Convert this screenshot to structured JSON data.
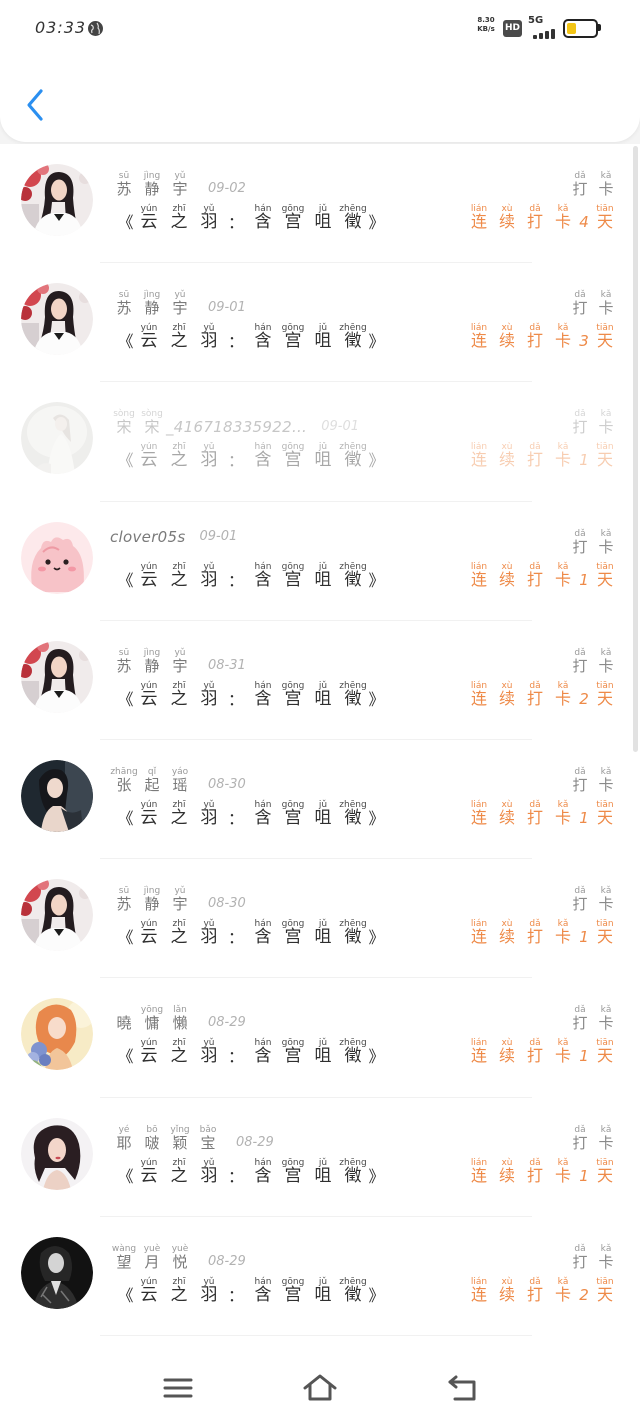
{
  "status_bar": {
    "time": "03:33",
    "net_speed": "8.30",
    "net_speed_unit": "KB/s",
    "hd_badge": "HD",
    "network_type": "5G",
    "signal_bars": 4,
    "battery_level": 0.35,
    "icons": {
      "globe": "globe-icon",
      "signal": "signal-icon",
      "battery": "battery-icon"
    }
  },
  "header": {
    "back_icon": "chevron-left-icon"
  },
  "colors": {
    "accent": "#2b8ff0",
    "streak": "#ee8a48",
    "name": "#7a7a7a",
    "date": "#b2b2b2",
    "title": "#2f2f2f",
    "label": "#8a8a8a",
    "nav": "#555555"
  },
  "checkin_label": [
    {
      "c": "打",
      "p": "dǎ"
    },
    {
      "c": "卡",
      "p": "kǎ"
    }
  ],
  "book_title": {
    "open": "《",
    "part1": [
      {
        "c": "云",
        "p": "yún"
      },
      {
        "c": "之",
        "p": "zhī"
      },
      {
        "c": "羽",
        "p": "yǔ"
      }
    ],
    "sep": "：",
    "part2": [
      {
        "c": "含",
        "p": "hán"
      },
      {
        "c": "宫",
        "p": "gōng"
      },
      {
        "c": "咀",
        "p": "jǔ"
      },
      {
        "c": "徵",
        "p": "zhēng"
      }
    ],
    "close": "》"
  },
  "streak": {
    "prefix": [
      {
        "c": "连",
        "p": "lián"
      },
      {
        "c": "续",
        "p": "xù"
      },
      {
        "c": "打",
        "p": "dǎ"
      },
      {
        "c": "卡",
        "p": "kǎ"
      }
    ],
    "suffix": {
      "c": "天",
      "p": "tiān"
    }
  },
  "records": [
    {
      "avatar": "girl-portrait",
      "name": [
        {
          "c": "苏",
          "p": "sū"
        },
        {
          "c": "静",
          "p": "jìng"
        },
        {
          "c": "宇",
          "p": "yǔ"
        }
      ],
      "date": "09-02",
      "days": "4"
    },
    {
      "avatar": "girl-portrait",
      "name": [
        {
          "c": "苏",
          "p": "sū"
        },
        {
          "c": "静",
          "p": "jìng"
        },
        {
          "c": "宇",
          "p": "yǔ"
        }
      ],
      "date": "09-01",
      "days": "3"
    },
    {
      "avatar": "pale-figure",
      "name": [
        {
          "c": "宋",
          "p": "sòng"
        },
        {
          "c": "宋",
          "p": "sòng"
        }
      ],
      "name_tail": "_416718335922…",
      "date": "09-01",
      "days": "1",
      "dimmed": true
    },
    {
      "avatar": "pink-cartoon",
      "name": [],
      "name_tail": "clover05s",
      "date": "09-01",
      "days": "1"
    },
    {
      "avatar": "girl-portrait",
      "name": [
        {
          "c": "苏",
          "p": "sū"
        },
        {
          "c": "静",
          "p": "jìng"
        },
        {
          "c": "宇",
          "p": "yǔ"
        }
      ],
      "date": "08-31",
      "days": "2"
    },
    {
      "avatar": "dark-portrait",
      "name": [
        {
          "c": "张",
          "p": "zhāng"
        },
        {
          "c": "起",
          "p": "qǐ"
        },
        {
          "c": "瑶",
          "p": "yáo"
        }
      ],
      "date": "08-30",
      "days": "1"
    },
    {
      "avatar": "girl-portrait",
      "name": [
        {
          "c": "苏",
          "p": "sū"
        },
        {
          "c": "静",
          "p": "jìng"
        },
        {
          "c": "宇",
          "p": "yǔ"
        }
      ],
      "date": "08-30",
      "days": "1"
    },
    {
      "avatar": "warm-illustration",
      "name": [
        {
          "c": "曉",
          "p": ""
        },
        {
          "c": "慵",
          "p": "yōng"
        },
        {
          "c": "懶",
          "p": "lǎn"
        }
      ],
      "date": "08-29",
      "days": "1"
    },
    {
      "avatar": "curly-portrait",
      "name": [
        {
          "c": "耶",
          "p": "yé"
        },
        {
          "c": "啵",
          "p": "bō"
        },
        {
          "c": "颖",
          "p": "yǐng"
        },
        {
          "c": "宝",
          "p": "bǎo"
        }
      ],
      "date": "08-29",
      "days": "1"
    },
    {
      "avatar": "monochrome-portrait",
      "name": [
        {
          "c": "望",
          "p": "wàng"
        },
        {
          "c": "月",
          "p": "yuè"
        },
        {
          "c": "悦",
          "p": "yuè"
        }
      ],
      "date": "08-29",
      "days": "2"
    }
  ],
  "nav": {
    "menu_icon": "menu-icon",
    "home_icon": "home-icon",
    "back_icon": "back-icon"
  }
}
